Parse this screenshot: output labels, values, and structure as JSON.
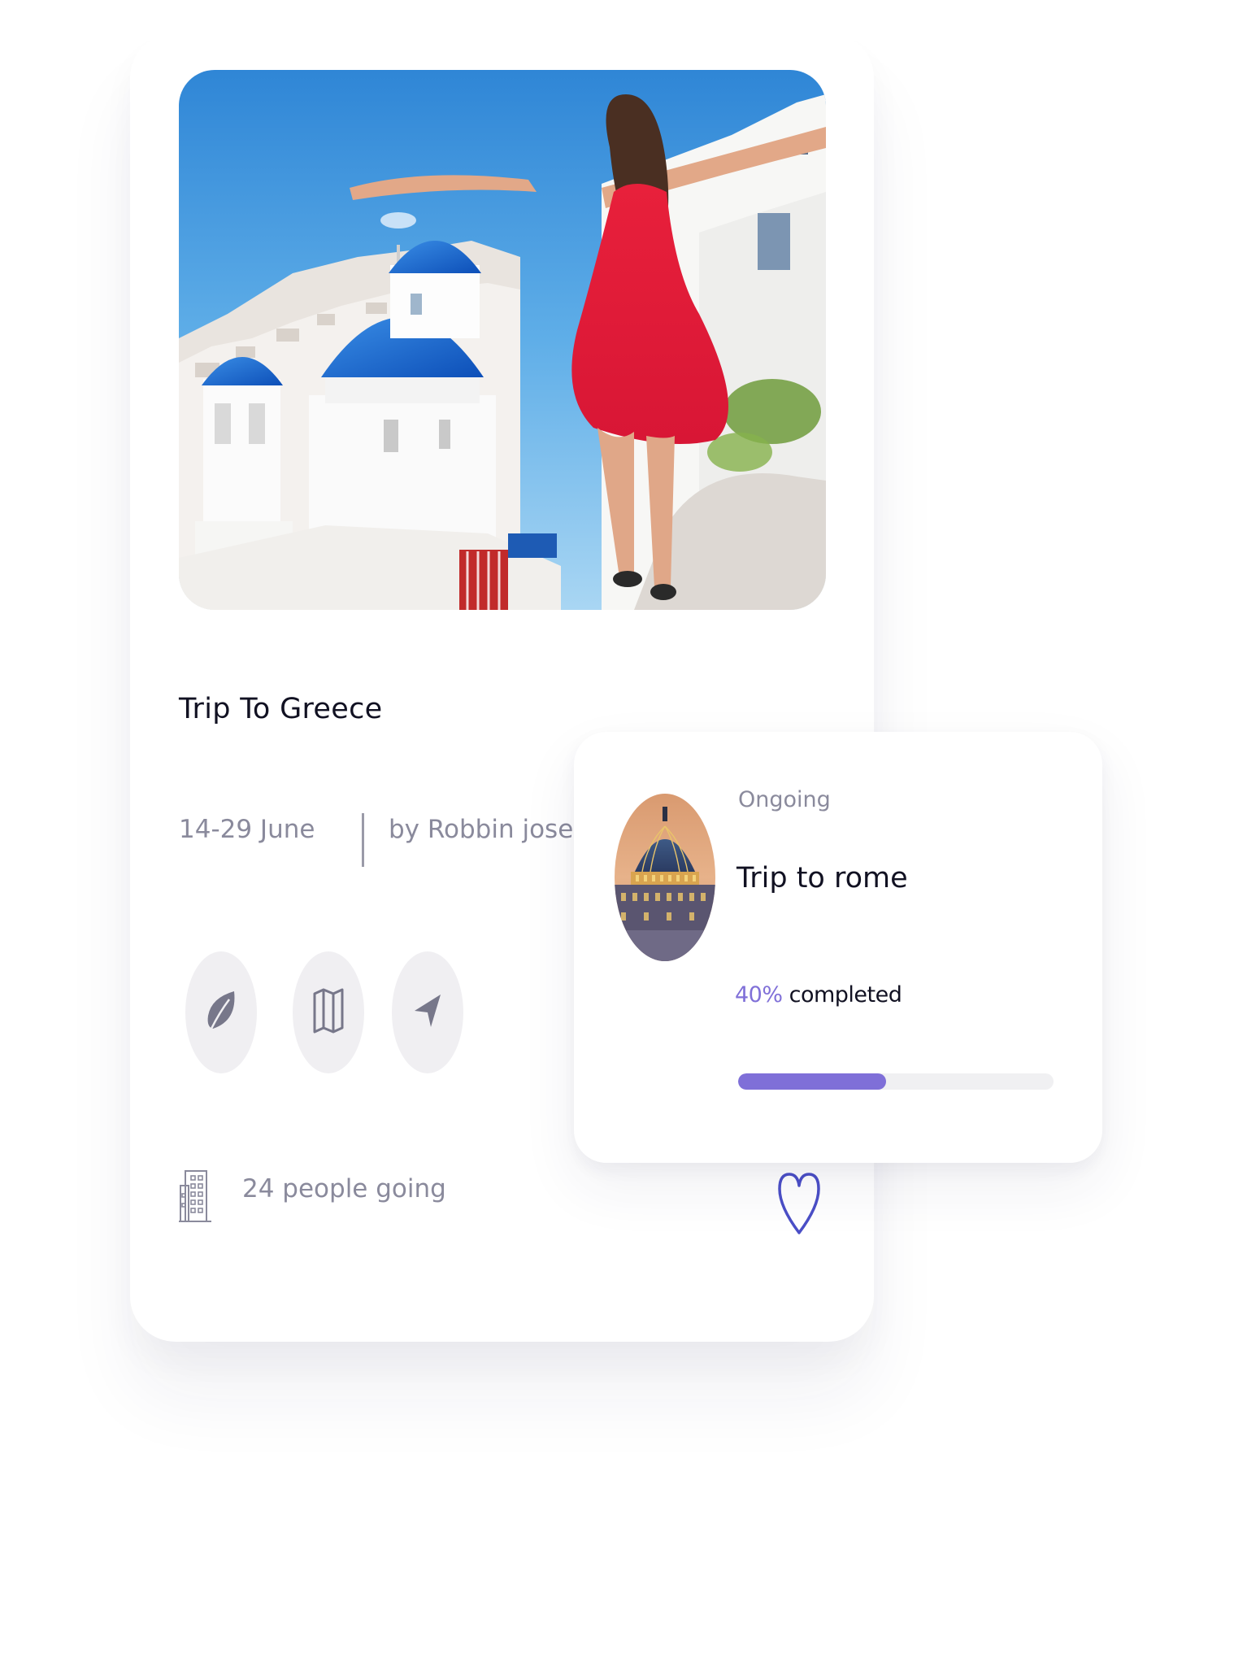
{
  "main_card": {
    "title": "Trip To Greece",
    "dates": "14-29 June",
    "author": "by Robbin jose",
    "people_going": "24 people going",
    "action_icons": [
      "leaf-icon",
      "map-icon",
      "navigation-icon"
    ],
    "footer_icons": [
      "building-icon",
      "heart-icon"
    ]
  },
  "ongoing_card": {
    "status": "Ongoing",
    "title": "Trip to rome",
    "progress_percent_label": "40%",
    "progress_suffix": " completed",
    "progress_value": 0.47
  },
  "colors": {
    "accent": "#7f6fd8",
    "heart": "#4b4fc7",
    "muted_text": "#8a8a9c",
    "pill_bg": "#f0eff2"
  }
}
